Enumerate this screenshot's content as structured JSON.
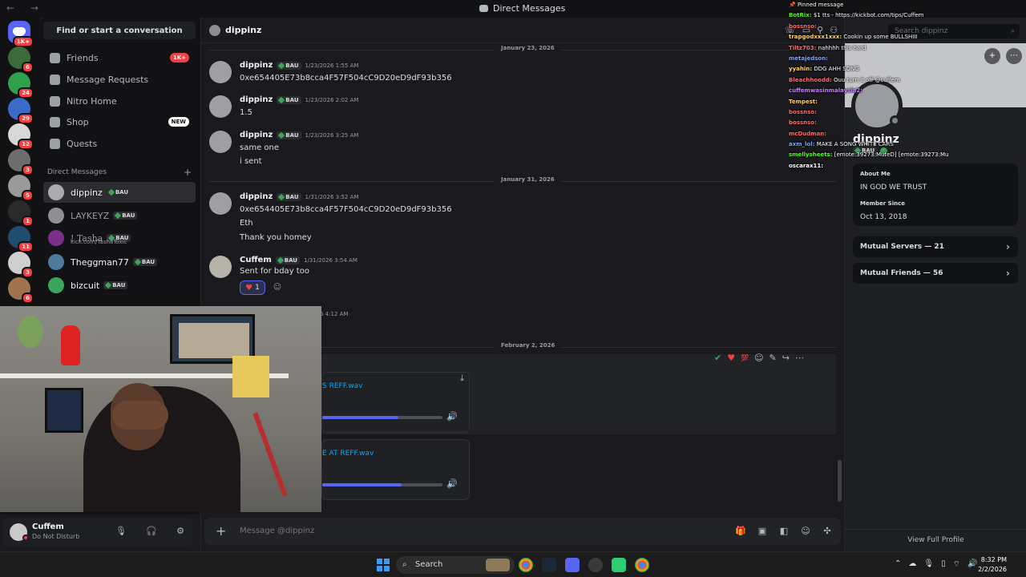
{
  "window": {
    "title": "Direct Messages",
    "nav": "← →"
  },
  "servers": [
    {
      "name": "Discord Home",
      "badge": "1K+"
    },
    {
      "badge": "6"
    },
    {
      "badge": "24"
    },
    {
      "badge": "29"
    },
    {
      "badge": "12"
    },
    {
      "badge": "3"
    },
    {
      "badge": "5"
    },
    {
      "badge": "1"
    },
    {
      "badge": "11"
    },
    {
      "badge": "3"
    },
    {
      "badge": "6"
    }
  ],
  "sidebar": {
    "find_label": "Find or start a conversation",
    "nav": [
      {
        "label": "Friends",
        "pill": "1K+"
      },
      {
        "label": "Message Requests",
        "pill": ""
      },
      {
        "label": "Nitro Home",
        "pill": ""
      },
      {
        "label": "Shop",
        "pill": "NEW"
      },
      {
        "label": "Quests",
        "pill": ""
      }
    ],
    "dm_header": "Direct Messages",
    "dm_plus": "+",
    "dms": [
      {
        "name": "dippinz",
        "tag": "BAU",
        "sub": ""
      },
      {
        "name": "LAYKEYZ",
        "tag": "BAU",
        "sub": ""
      },
      {
        "name": "! Tasha",
        "tag": "BAU",
        "sub": "kick.com/TashaToxic"
      },
      {
        "name": "Theggman77",
        "tag": "BAU",
        "sub": ""
      },
      {
        "name": "bizcuit",
        "tag": "BAU",
        "sub": ""
      }
    ]
  },
  "user": {
    "name": "Cuffem",
    "status": "Do Not Disturb"
  },
  "chat": {
    "recipient": "dippinz",
    "placeholder": "Message @dippinz",
    "dividers": [
      "January 23, 2026",
      "January 31, 2026",
      "February 2, 2026"
    ],
    "messages": [
      {
        "author": "dippinz",
        "tag": "BAU",
        "time": "1/23/2026 1:55 AM",
        "lines": [
          "0xe654405E73b8cca4F57F504cC9D20eD9dF93b356"
        ]
      },
      {
        "author": "dippinz",
        "tag": "BAU",
        "time": "1/23/2026 2:02 AM",
        "lines": [
          "1.5"
        ]
      },
      {
        "author": "dippinz",
        "tag": "BAU",
        "time": "1/23/2026 3:25 AM",
        "lines": [
          "same one",
          "i sent"
        ]
      },
      {
        "author": "dippinz",
        "tag": "BAU",
        "time": "1/31/2026 3:52 AM",
        "lines": [
          "0xe654405E73b8cca4F57F504cC9D20eD9dF93b356",
          "Eth",
          "Thank you  homey"
        ]
      },
      {
        "author": "Cuffem",
        "tag": "BAU",
        "time": "1/31/2026 3:54 AM",
        "lines": [
          "Sent for bday too"
        ],
        "reaction_count": "1"
      }
    ],
    "partial_time": "6 4:12 AM",
    "attachments": [
      {
        "filename": "S REFF.wav",
        "progress": 0.63
      },
      {
        "filename": "E AT REFF.wav",
        "progress": 0.66
      }
    ]
  },
  "profile": {
    "search_placeholder": "Search dippinz",
    "display_name": "dippinz",
    "username": "BAU",
    "about_heading": "About Me",
    "about_text": "IN GOD WE TRUST",
    "member_heading": "Member Since",
    "member_date": "Oct 13, 2018",
    "mutual_servers": "Mutual Servers — 21",
    "mutual_friends": "Mutual Friends — 56",
    "view_full": "View Full Profile"
  },
  "stream_chat": [
    {
      "user": "",
      "text": "📌 Pinned message",
      "color": "#ffffff"
    },
    {
      "user": "BotRix:",
      "text": "$1 tts - https://kickbot.com/tips/Cuffem",
      "color": "#53fc18"
    },
    {
      "user": "bossnso:",
      "text": "",
      "color": "#ff6b6b"
    },
    {
      "user": "trapgodxxx1xxx:",
      "text": "Cookin up some BULLSHIII",
      "color": "#ffd166"
    },
    {
      "user": "Tiltz703:",
      "text": "nahhhh this hard",
      "color": "#ff6b6b"
    },
    {
      "user": "metajedson:",
      "text": "",
      "color": "#7aa2ff"
    },
    {
      "user": "yyahin:",
      "text": "DDG AHH SONG",
      "color": "#ffd166"
    },
    {
      "user": "Bleachhoodd:",
      "text": "Ouu turn it off @cuffem",
      "color": "#ff6b6b"
    },
    {
      "user": "cuffemwasinmalaysia2:",
      "text": "",
      "color": "#c77dff"
    },
    {
      "user": "Tempest:",
      "text": "",
      "color": "#ffd166"
    },
    {
      "user": "bossnso:",
      "text": "",
      "color": "#ff6b6b"
    },
    {
      "user": "bossnso:",
      "text": "",
      "color": "#ff6b6b"
    },
    {
      "user": "mcDudman:",
      "text": "",
      "color": "#ff6b6b"
    },
    {
      "user": "axm_lol:",
      "text": "MAKE A SONG WHITE CARS",
      "color": "#7aa2ff"
    },
    {
      "user": "smellysheets:",
      "text": "[emote:39273:MuteD] [emote:39273:MuteD]",
      "color": "#53fc18"
    },
    {
      "user": "oscarax11:",
      "text": "",
      "color": "#ffffff"
    }
  ],
  "taskbar": {
    "search_label": "Search",
    "time": "8:32 PM",
    "date": "2/2/2026"
  },
  "colors": {
    "accent": "#5865f2",
    "danger": "#f23f43",
    "link": "#00a8fc",
    "online": "#3ba55d"
  }
}
